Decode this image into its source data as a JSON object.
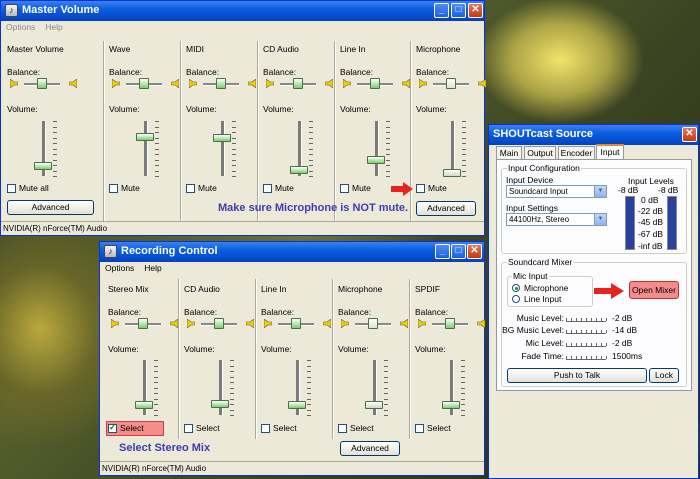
{
  "master": {
    "title": "Master Volume",
    "menu": [
      "Options",
      "Help"
    ],
    "columns": [
      {
        "name": "Master Volume",
        "mute": "Mute all",
        "muted": false
      },
      {
        "name": "Wave",
        "mute": "Mute",
        "muted": false
      },
      {
        "name": "MIDI",
        "mute": "Mute",
        "muted": false
      },
      {
        "name": "CD Audio",
        "mute": "Mute",
        "muted": false
      },
      {
        "name": "Line In",
        "mute": "Mute",
        "muted": false
      },
      {
        "name": "Microphone",
        "mute": "Mute",
        "muted": false
      }
    ],
    "balance_label": "Balance:",
    "volume_label": "Volume:",
    "advanced": "Advanced",
    "status": "NVIDIA(R) nForce(TM) Audio",
    "annotation": "Make sure Microphone is NOT mute."
  },
  "recording": {
    "title": "Recording Control",
    "menu": [
      "Options",
      "Help"
    ],
    "columns": [
      {
        "name": "Stereo Mix",
        "select": "Select",
        "selected": true
      },
      {
        "name": "CD Audio",
        "select": "Select",
        "selected": false
      },
      {
        "name": "Line In",
        "select": "Select",
        "selected": false
      },
      {
        "name": "Microphone",
        "select": "Select",
        "selected": false
      },
      {
        "name": "SPDIF",
        "select": "Select",
        "selected": false
      }
    ],
    "balance_label": "Balance:",
    "volume_label": "Volume:",
    "advanced": "Advanced",
    "status": "NVIDIA(R) nForce(TM) Audio",
    "annotation": "Select Stereo Mix"
  },
  "shoutcast": {
    "title": "SHOUTcast Source",
    "tabs": [
      "Main",
      "Output",
      "Encoder",
      "Input"
    ],
    "active_tab": "Input",
    "input_config": {
      "group": "Input Configuration",
      "device_label": "Input Device",
      "device_value": "Soundcard Input",
      "settings_label": "Input Settings",
      "settings_value": "44100Hz, Stereo",
      "levels_label": "Input Levels",
      "left_level": "-8 dB",
      "right_level": "-8 dB",
      "scale": [
        "0 dB",
        "-22 dB",
        "-45 dB",
        "-67 dB",
        "-inf dB"
      ]
    },
    "mixer": {
      "group": "Soundcard Mixer",
      "mic_input": "Mic Input",
      "option_microphone": "Microphone",
      "option_line": "Line Input",
      "selected": "Microphone",
      "open_mixer": "Open Mixer",
      "rows": [
        {
          "label": "Music Level:",
          "value": "-2 dB"
        },
        {
          "label": "BG Music Level:",
          "value": "-14 dB"
        },
        {
          "label": "Mic Level:",
          "value": "-2 dB"
        },
        {
          "label": "Fade Time:",
          "value": "1500ms"
        }
      ],
      "push_to_talk": "Push to Talk",
      "lock": "Lock"
    }
  },
  "colors": {
    "title_bar": "#0a5fe0",
    "highlight": "#f58c8c",
    "annotation": "#3b3fb0",
    "arrow": "#e8231b"
  }
}
